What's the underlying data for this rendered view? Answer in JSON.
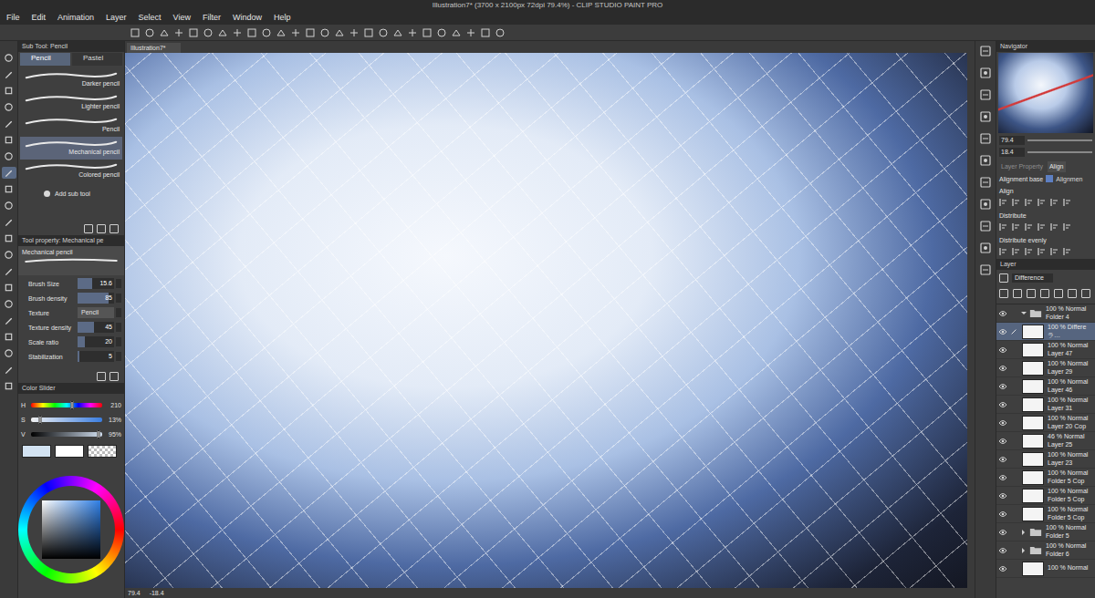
{
  "window": {
    "title": "Illustration7* (3700 x 2100px 72dpi 79.4%) - CLIP STUDIO PAINT PRO"
  },
  "menu": [
    "File",
    "Edit",
    "Animation",
    "Layer",
    "Select",
    "View",
    "Filter",
    "Window",
    "Help"
  ],
  "toolbox": [
    {
      "selected": false
    },
    {
      "selected": false
    },
    {
      "selected": false
    },
    {
      "selected": false
    },
    {
      "selected": false
    },
    {
      "selected": false
    },
    {
      "selected": false
    },
    {
      "selected": true
    },
    {
      "selected": false
    },
    {
      "selected": false
    },
    {
      "selected": false
    },
    {
      "selected": false
    },
    {
      "selected": false
    },
    {
      "selected": false
    },
    {
      "selected": false
    },
    {
      "selected": false
    },
    {
      "selected": false
    },
    {
      "selected": false
    },
    {
      "selected": false
    },
    {
      "selected": false
    },
    {
      "selected": false
    }
  ],
  "sub_tool": {
    "title": "Sub Tool: Pencil",
    "tabs": [
      {
        "label": "Pencil",
        "selected": true
      },
      {
        "label": "Pastel",
        "selected": false
      }
    ],
    "items": [
      {
        "label": "Darker pencil",
        "selected": false
      },
      {
        "label": "Lighter pencil",
        "selected": false
      },
      {
        "label": "Pencil",
        "selected": false
      },
      {
        "label": "Mechanical pencil",
        "selected": true
      },
      {
        "label": "Colored pencil",
        "selected": false
      }
    ],
    "add_label": "Add sub tool"
  },
  "tool_property": {
    "title": "Tool property: Mechanical pe",
    "preset": "Mechanical pencil",
    "rows": [
      {
        "kind": "slider",
        "label": "Brush Size",
        "value": "15.6",
        "level": 0.4
      },
      {
        "kind": "slider",
        "label": "Brush density",
        "value": "85",
        "level": 0.85
      },
      {
        "kind": "select",
        "label": "Texture",
        "value": "Pencil",
        "level": 0
      },
      {
        "kind": "slider",
        "label": "Texture density",
        "value": "45",
        "level": 0.45
      },
      {
        "kind": "slider",
        "label": "Scale ratio",
        "value": "20",
        "level": 0.2
      },
      {
        "kind": "slider",
        "label": "Stabilization",
        "value": "5",
        "level": 0.05
      }
    ]
  },
  "color_slider": {
    "title": "Color Slider",
    "channels": [
      {
        "label": "H",
        "value": "210",
        "level": 0.583
      },
      {
        "label": "S",
        "value": "13%",
        "level": 0.13
      },
      {
        "label": "V",
        "value": "95%",
        "level": 0.95
      }
    ]
  },
  "canvas": {
    "tab": "Illustration7*",
    "zoom": "79.4",
    "angle": "-18.4"
  },
  "navigator": {
    "title": "Navigator",
    "zoom": "79.4",
    "angle": "18.4"
  },
  "property_tabs": [
    {
      "label": "Layer Property",
      "selected": false
    },
    {
      "label": "Align",
      "selected": true
    }
  ],
  "align": {
    "base_label": "Alignment base",
    "cut_label": "Alignmen",
    "sections": [
      "Align",
      "Distribute",
      "Distribute evenly"
    ]
  },
  "layers": {
    "title": "Layer",
    "blend_mode": "Difference",
    "rows": [
      {
        "kind": "folder",
        "info": "100 % Normal",
        "name": "Folder 4",
        "selected": false,
        "expanded": true,
        "visible": true
      },
      {
        "kind": "layer",
        "info": "100 % Differe",
        "name": "ラ…",
        "selected": true,
        "expanded": false,
        "visible": true
      },
      {
        "kind": "layer",
        "info": "100 % Normal",
        "name": "Layer 47",
        "selected": false,
        "expanded": false,
        "visible": true
      },
      {
        "kind": "layer",
        "info": "100 % Normal",
        "name": "Layer 29",
        "selected": false,
        "expanded": false,
        "visible": true
      },
      {
        "kind": "layer",
        "info": "100 % Normal",
        "name": "Layer 46",
        "selected": false,
        "expanded": false,
        "visible": true
      },
      {
        "kind": "layer",
        "info": "100 % Normal",
        "name": "Layer 31",
        "selected": false,
        "expanded": false,
        "visible": true
      },
      {
        "kind": "layer",
        "info": "100 % Normal",
        "name": "Layer 20 Cop",
        "selected": false,
        "expanded": false,
        "visible": true
      },
      {
        "kind": "layer",
        "info": "46 % Normal",
        "name": "Layer 25",
        "selected": false,
        "expanded": false,
        "visible": true
      },
      {
        "kind": "layer",
        "info": "100 % Normal",
        "name": "Layer 23",
        "selected": false,
        "expanded": false,
        "visible": true
      },
      {
        "kind": "layer",
        "info": "100 % Normal",
        "name": "Folder 5 Cop",
        "selected": false,
        "expanded": false,
        "visible": true
      },
      {
        "kind": "layer",
        "info": "100 % Normal",
        "name": "Folder 5 Cop",
        "selected": false,
        "expanded": false,
        "visible": true
      },
      {
        "kind": "layer",
        "info": "100 % Normal",
        "name": "Folder 5 Cop",
        "selected": false,
        "expanded": false,
        "visible": true
      },
      {
        "kind": "folder",
        "info": "100 % Normal",
        "name": "Folder 5",
        "selected": false,
        "expanded": false,
        "visible": true
      },
      {
        "kind": "folder",
        "info": "100 % Normal",
        "name": "Folder 6",
        "selected": false,
        "expanded": false,
        "visible": true
      },
      {
        "kind": "layer",
        "info": "100 % Normal",
        "name": "",
        "selected": false,
        "expanded": false,
        "visible": true
      }
    ]
  }
}
